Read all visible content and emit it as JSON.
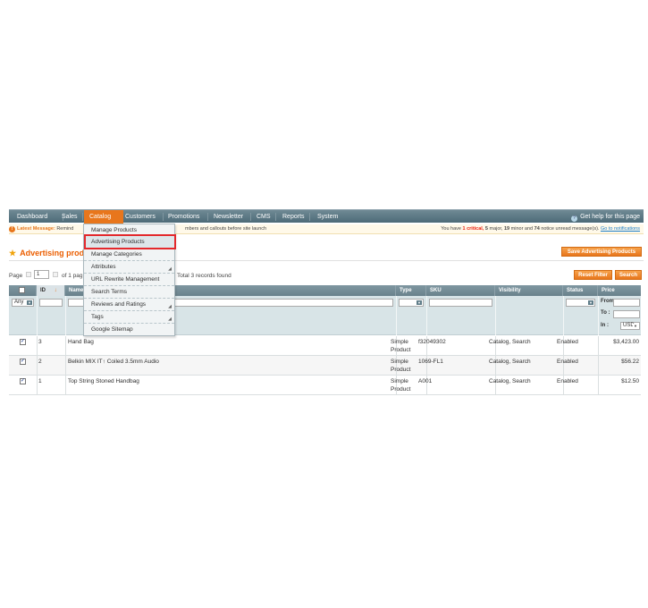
{
  "nav": {
    "items": [
      "Dashboard",
      "Sales",
      "Catalog",
      "Customers",
      "Promotions",
      "Newsletter",
      "CMS",
      "Reports",
      "System"
    ],
    "active": "Catalog",
    "help": "Get help for this page"
  },
  "message": {
    "label": "Latest Message:",
    "text": "Remind",
    "text_tail": "mbers and callouts before site launch",
    "summary_pre": "You have",
    "critical_count": "1",
    "critical_label": "critical,",
    "major_count": "5",
    "major_label": "major,",
    "minor_count": "19",
    "minor_label": "minor and",
    "notice_count": "74",
    "notice_label": "notice unread message(s).",
    "link": "Go to notifications"
  },
  "page": {
    "title": "Advertising produ",
    "save_button": "Save Advertising Products",
    "reset_button": "Reset Filter",
    "search_button": "Search"
  },
  "pager": {
    "page_label": "Page",
    "page_value": "1",
    "of_pages": "of 1 pag",
    "records": "Total 3 records found"
  },
  "menu": {
    "items": [
      {
        "label": "Manage Products",
        "submenu": false
      },
      {
        "label": "Advertising Products",
        "submenu": false
      },
      {
        "label": "Manage Categories",
        "submenu": false
      },
      {
        "label": "Attributes",
        "submenu": true
      },
      {
        "label": "URL Rewrite Management",
        "submenu": false
      },
      {
        "label": "Search Terms",
        "submenu": false
      },
      {
        "label": "Reviews and Ratings",
        "submenu": true
      },
      {
        "label": "Tags",
        "submenu": true
      },
      {
        "label": "Google Sitemap",
        "submenu": false
      }
    ]
  },
  "grid": {
    "columns": {
      "id": "ID",
      "name": "Name",
      "type": "Type",
      "sku": "SKU",
      "visibility": "Visibility",
      "status": "Status",
      "price": "Price"
    },
    "sort_arrow": "↓",
    "filter": {
      "any": "Any",
      "from": "From:",
      "to": "To :",
      "in": "In :",
      "currency": "USD"
    },
    "rows": [
      {
        "id": "3",
        "name": "Hand Bag",
        "type_line1": "Simple",
        "type_line2": "Product",
        "sku": "f32049302",
        "visibility": "Catalog, Search",
        "status": "Enabled",
        "price": "$3,423.00"
      },
      {
        "id": "2",
        "name": "Belkin MIX IT↑ Coiled 3.5mm Audio",
        "type_line1": "Simple",
        "type_line2": "Product",
        "sku": "1069-FL1",
        "visibility": "Catalog, Search",
        "status": "Enabled",
        "price": "$56.22"
      },
      {
        "id": "1",
        "name": "Top String Stoned Handbag",
        "type_line1": "Simple",
        "type_line2": "Product",
        "sku": "A001",
        "visibility": "Catalog, Search",
        "status": "Enabled",
        "price": "$12.50"
      }
    ]
  }
}
